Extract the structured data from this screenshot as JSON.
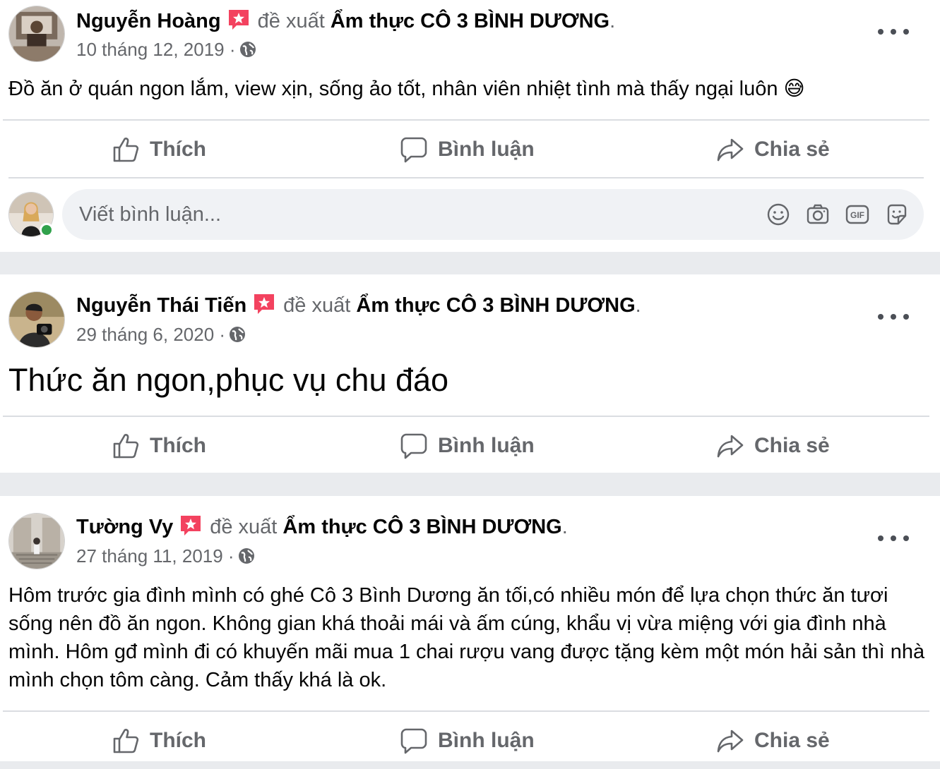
{
  "posts": [
    {
      "author": "Nguyễn Hoàng",
      "recommends": "đề xuất",
      "page": "Ẩm thực CÔ 3 BÌNH DƯƠNG",
      "period": ".",
      "date": "10 tháng 12, 2019 ·",
      "text": "Đồ ăn ở quán ngon lắm, view xịn, sống ảo tốt, nhân viên nhiệt tình mà thấy ngại luôn 😅"
    },
    {
      "author": "Nguyễn Thái Tiến",
      "recommends": "đề xuất",
      "page": "Ẩm thực CÔ 3 BÌNH DƯƠNG",
      "period": ".",
      "date": "29 tháng 6, 2020 ·",
      "text": "Thức ăn ngon,phục vụ chu đáo"
    },
    {
      "author": "Tường Vy",
      "recommends": "đề xuất",
      "page": "Ẩm thực CÔ 3 BÌNH DƯƠNG",
      "period": ".",
      "date": "27 tháng 11, 2019 ·",
      "text": "Hôm trước gia đình mình có ghé Cô 3 Bình Dương ăn tối,có nhiều món để lựa chọn thức ăn tươi sống nên đồ ăn ngon. Không gian khá thoải mái và ấm cúng, khẩu vị vừa miệng với gia đình nhà mình. Hôm gđ mình đi có khuyến mãi mua 1 chai rượu vang được tặng kèm một món hải sản thì nhà mình chọn tôm càng. Cảm thấy khá là ok."
    }
  ],
  "actions": {
    "like": "Thích",
    "comment": "Bình luận",
    "share": "Chia sẻ"
  },
  "comment_input": {
    "placeholder": "Viết bình luận...",
    "icons": [
      "emoji-icon",
      "camera-icon",
      "gif-icon",
      "sticker-icon"
    ]
  },
  "colors": {
    "background": "#e9ebee",
    "card": "#ffffff",
    "muted_text": "#65676b",
    "recommend_badge": "#f3425f",
    "online": "#31a24c"
  }
}
